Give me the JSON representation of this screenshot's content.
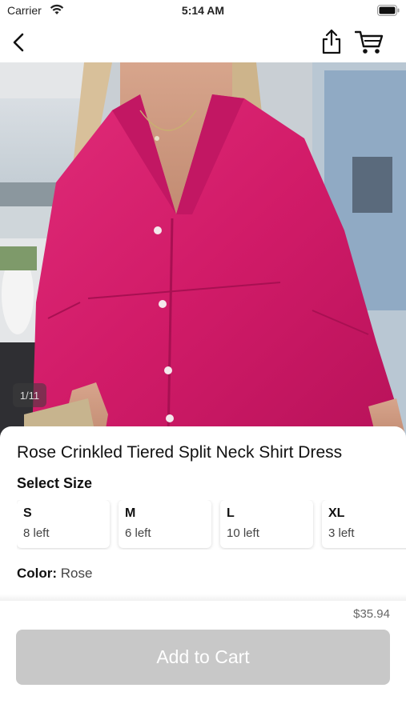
{
  "status_bar": {
    "carrier": "Carrier",
    "time": "5:14 AM",
    "icons": [
      "wifi-icon",
      "battery-icon"
    ]
  },
  "nav": {
    "icons": [
      "chevron-left-icon",
      "share-icon",
      "cart-icon"
    ]
  },
  "gallery": {
    "counter": "1/11",
    "image_description_icon": "product-photo"
  },
  "product": {
    "title": "Rose Crinkled Tiered Split Neck Shirt Dress",
    "select_size_label": "Select Size",
    "sizes": [
      {
        "name": "S",
        "stock": "8 left"
      },
      {
        "name": "M",
        "stock": "6 left"
      },
      {
        "name": "L",
        "stock": "10 left"
      },
      {
        "name": "XL",
        "stock": "3 left"
      }
    ],
    "color_label": "Color:",
    "color_value": "Rose",
    "price": "$35.94",
    "add_to_cart_label": "Add to Cart"
  },
  "colors": {
    "dress": "#d61e6d",
    "button_disabled": "#c8c8c8",
    "text_primary": "#111111",
    "text_secondary": "#444444"
  }
}
